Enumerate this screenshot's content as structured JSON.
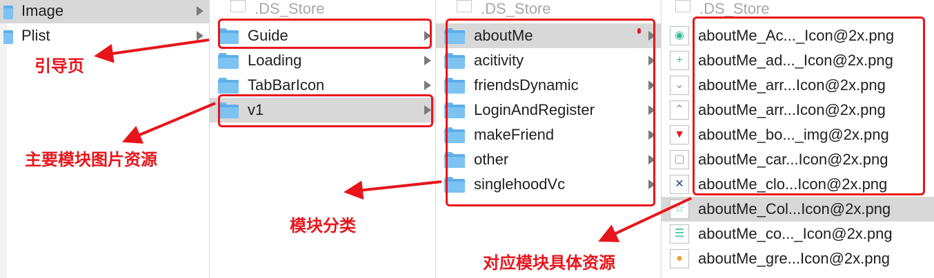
{
  "columns": {
    "col1": {
      "items": [
        {
          "label": "Image",
          "selected": true
        },
        {
          "label": "Plist",
          "selected": false
        }
      ]
    },
    "col2": {
      "header": ".DS_Store",
      "items": [
        {
          "label": "Guide",
          "selected": false
        },
        {
          "label": "Loading",
          "selected": false
        },
        {
          "label": "TabBarIcon",
          "selected": false
        },
        {
          "label": "v1",
          "selected": true
        }
      ]
    },
    "col3": {
      "header": ".DS_Store",
      "items": [
        {
          "label": "aboutMe",
          "selected": true
        },
        {
          "label": "acitivity",
          "selected": false
        },
        {
          "label": "friendsDynamic",
          "selected": false
        },
        {
          "label": "LoginAndRegister",
          "selected": false
        },
        {
          "label": "makeFriend",
          "selected": false
        },
        {
          "label": "other",
          "selected": false
        },
        {
          "label": "singlehoodVc",
          "selected": false
        }
      ]
    },
    "col4": {
      "header": ".DS_Store",
      "items": [
        {
          "label": "aboutMe_Ac..._Icon@2x.png",
          "icon": "eye-icon",
          "color": "#2fbf9a"
        },
        {
          "label": "aboutMe_ad..._Icon@2x.png",
          "icon": "plus-icon",
          "color": "#2fbf9a"
        },
        {
          "label": "aboutMe_arr...Icon@2x.png",
          "icon": "chevron-down-icon",
          "color": "#8c8c8c"
        },
        {
          "label": "aboutMe_arr...Icon@2x.png",
          "icon": "chevron-up-icon",
          "color": "#8c8c8c"
        },
        {
          "label": "aboutMe_bo..._img@2x.png",
          "icon": "bookmark-icon",
          "color": "#e8141b"
        },
        {
          "label": "aboutMe_car...Icon@2x.png",
          "icon": "card-icon",
          "color": "#9a9a9a"
        },
        {
          "label": "aboutMe_clo...Icon@2x.png",
          "icon": "close-icon",
          "color": "#2a4a8a"
        },
        {
          "label": "aboutMe_Col...Icon@2x.png",
          "icon": "star-icon",
          "color": "#2fbf9a",
          "selected": true
        },
        {
          "label": "aboutMe_co..._Icon@2x.png",
          "icon": "list-icon",
          "color": "#2fbf9a"
        },
        {
          "label": "aboutMe_gre...Icon@2x.png",
          "icon": "circle-icon",
          "color": "#f0a030"
        }
      ]
    }
  },
  "annotations": {
    "guide": "引导页",
    "main_module": "主要模块图片资源",
    "module_category": "模块分类",
    "module_resources": "对应模块具体资源"
  },
  "colors": {
    "annotation_red": "#e8141b",
    "selection_gray": "#d8d8d8",
    "folder_blue": "#5daeea"
  }
}
